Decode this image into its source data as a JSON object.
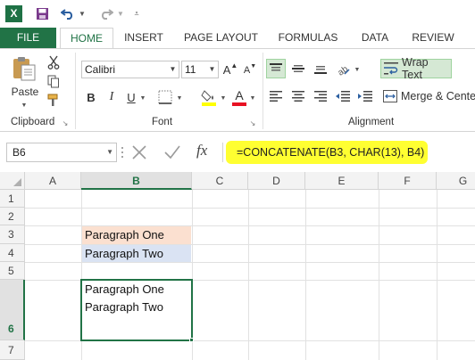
{
  "quick_access": {
    "app_icon": "excel-icon",
    "icons": [
      "save-icon",
      "undo-icon",
      "redo-icon",
      "customize-qat-icon"
    ]
  },
  "ribbon_tabs": [
    {
      "label": "FILE"
    },
    {
      "label": "HOME"
    },
    {
      "label": "INSERT"
    },
    {
      "label": "PAGE LAYOUT"
    },
    {
      "label": "FORMULAS"
    },
    {
      "label": "DATA"
    },
    {
      "label": "REVIEW"
    }
  ],
  "clipboard": {
    "paste_label": "Paste",
    "group_label": "Clipboard"
  },
  "font": {
    "name": "Calibri",
    "size": "11",
    "grow_label": "A",
    "shrink_label": "A",
    "bold": "B",
    "italic": "I",
    "underline": "U",
    "font_color_label": "A",
    "group_label": "Font"
  },
  "alignment": {
    "wrap_text": "Wrap Text",
    "merge_center": "Merge & Center",
    "group_label": "Alignment"
  },
  "formula_bar": {
    "name_box": "B6",
    "fx_label": "fx",
    "formula": "=CONCATENATE(B3, CHAR(13), B4)"
  },
  "grid": {
    "columns": [
      "A",
      "B",
      "C",
      "D",
      "E",
      "F",
      "G"
    ],
    "selected_column": "B",
    "rows": [
      "1",
      "2",
      "3",
      "4",
      "5",
      "6",
      "7"
    ],
    "selected_row": "6",
    "cells": {
      "B3": "Paragraph One",
      "B4": "Paragraph Two",
      "B6_line1": "Paragraph One",
      "B6_line2": "Paragraph Two"
    },
    "fill_colors": {
      "B3": "#fbe0d0",
      "B4": "#dae3f3"
    }
  },
  "colors": {
    "excel_green": "#217346",
    "formula_highlight": "#ffff31"
  }
}
